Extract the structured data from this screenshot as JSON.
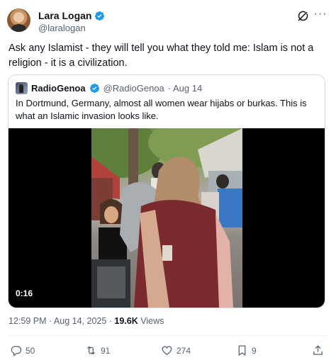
{
  "author": {
    "name": "Lara Logan",
    "handle": "@laralogan"
  },
  "tweet": {
    "text": "Ask any Islamist - they will tell you what they told me: Islam is not a religion - it is a civilization."
  },
  "quote": {
    "name": "RadioGenoa",
    "handle": "@RadioGenoa",
    "date": "· Aug 14",
    "text": "In Dortmund, Germany, almost all women wear hijabs or burkas. This is what an Islamic invasion looks like.",
    "video_duration": "0:16"
  },
  "meta": {
    "timestamp": "12:59 PM · Aug 14, 2025 · ",
    "views_count": "19.6K",
    "views_label": " Views"
  },
  "actions": {
    "replies": "50",
    "reposts": "91",
    "likes": "274",
    "bookmarks": "9"
  },
  "icons": [
    "verified-badge-icon",
    "grok-icon",
    "more-icon",
    "reply-icon",
    "repost-icon",
    "like-icon",
    "bookmark-icon",
    "share-icon"
  ],
  "colors": {
    "verified": "#1d9bf0",
    "text": "#0f1419",
    "muted": "#536471",
    "border": "#cfd9de"
  }
}
